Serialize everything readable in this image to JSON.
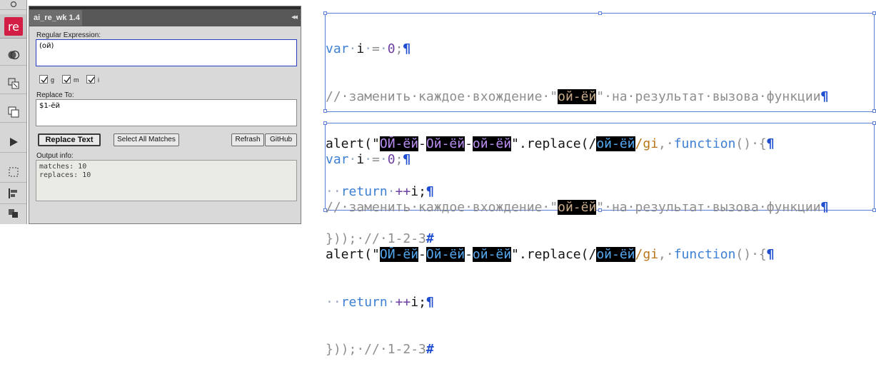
{
  "panel": {
    "title": "ai_re_wk 1.4",
    "collapse_glyph": "◂◂",
    "regex_label": "Regular Expression:",
    "regex_value": "(ой)",
    "flags": [
      {
        "label": "g",
        "checked": true
      },
      {
        "label": "m",
        "checked": true
      },
      {
        "label": "i",
        "checked": true
      }
    ],
    "replace_label": "Replace To:",
    "replace_value": "$1-ёй",
    "buttons": {
      "replace_text": "Replace Text",
      "select_all": "Select All Matches",
      "refresh": "Refrash",
      "github": "GitHub"
    },
    "output_label": "Output info:",
    "output_lines": [
      "matches: 10",
      "replaces: 10"
    ]
  },
  "toolbar": {
    "app_badge": "re",
    "icons": [
      "selection-icon",
      "re-app-icon",
      "shape-builder-icon",
      "artboard-icon",
      "layers-icon",
      "play-icon",
      "crop-area-icon",
      "align-icon",
      "pathfinder-icon"
    ]
  },
  "code_block_1": {
    "line1": {
      "t1": "var",
      "t2": "·",
      "t3": "i",
      "t4": "·",
      "t5": "=",
      "t6": "·",
      "t7": "0",
      "t8": ";",
      "t9": "¶"
    },
    "line2": {
      "t1": "//·заменить·каждое·вхождение·\"",
      "t2": "ой-ёй",
      "t3": "\"·на·результат·вызова·функции",
      "t4": "¶"
    },
    "line3": {
      "t1": "alert(\"",
      "t2": "ОЙ-ёй",
      "t3": "-",
      "t4": "Ой-ёй",
      "t5": "-",
      "t6": "ой-ёй",
      "t7": "\"",
      "t8": ".replace(/",
      "t9": "ой-ёй",
      "t10": "/gi",
      "t11": ",·",
      "t12": "function",
      "t13": "()·{",
      "t14": "¶"
    },
    "line4": {
      "t1": "··",
      "t2": "return",
      "t3": "·",
      "t4": "++",
      "t5": "i;",
      "t6": "¶"
    },
    "line5": {
      "t1": "}));·//·1-2-3",
      "t2": "#"
    }
  },
  "code_block_2": {
    "line1": {
      "t1": "var",
      "t2": "·",
      "t3": "i",
      "t4": "·",
      "t5": "=",
      "t6": "·",
      "t7": "0",
      "t8": ";",
      "t9": "¶"
    },
    "line2": {
      "t1": "//·заменить·каждое·вхождение·\"",
      "t2": "ой-ёй",
      "t3": "\"·на·результат·вызова·функции",
      "t4": "¶"
    },
    "line3": {
      "t1": "alert(\"",
      "t2": "ОЙ-ёй",
      "t3": "-",
      "t4": "Ой-ёй",
      "t5": "-",
      "t6": "ой-ёй",
      "t7": "\"",
      "t8": ".replace(/",
      "t9": "ой-ёй",
      "t10": "/gi",
      "t11": ",·",
      "t12": "function",
      "t13": "()·{",
      "t14": "¶"
    },
    "line4": {
      "t1": "··",
      "t2": "return",
      "t3": "·",
      "t4": "++",
      "t5": "i;",
      "t6": "¶"
    },
    "line5": {
      "t1": "}));·//·1-2-3",
      "t2": "#"
    }
  },
  "colors": {
    "app_badge": "#d21e45",
    "selection_frame": "#5a7fd6",
    "keyword": "#3c7fd3",
    "number": "#6c3fa1",
    "comment": "#8e8e8e"
  }
}
